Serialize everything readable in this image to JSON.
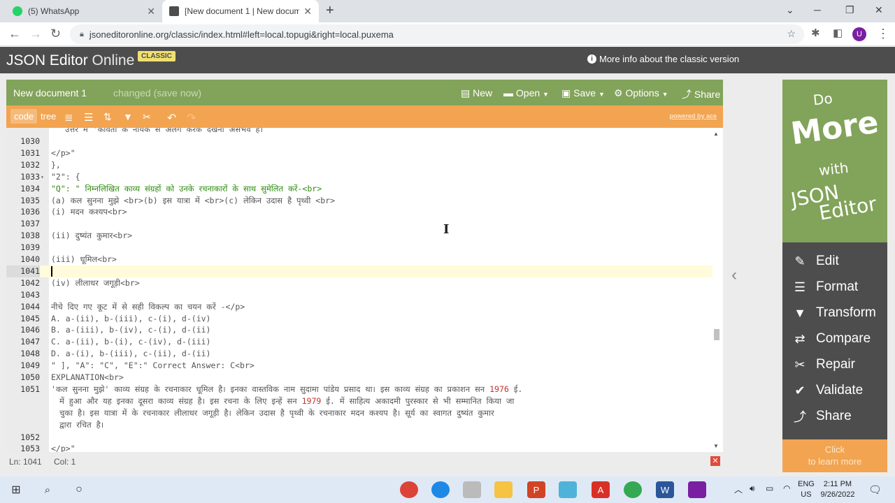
{
  "browser": {
    "tabs": [
      {
        "title": "(5) WhatsApp",
        "active": false
      },
      {
        "title": "[New document 1 | New docume",
        "active": true
      }
    ],
    "url": "jsoneditoronline.org/classic/index.html#left=local.topugi&right=local.puxema",
    "profile_initial": "U"
  },
  "app": {
    "brand_main": "JSON Editor",
    "brand_thin": "Online",
    "badge": "CLASSIC",
    "more_info": "More info about the classic version"
  },
  "menubar": {
    "doc_name": "New document 1",
    "changed": "changed (save now)",
    "items": [
      "New",
      "Open",
      "Save",
      "Options",
      "Share"
    ]
  },
  "toolbar": {
    "code": "code",
    "tree": "tree",
    "powered_by": "powered by ace"
  },
  "editor": {
    "partial_top": "उत्तर में 'कविता के नायक से अलग करके देखना असंभव है।",
    "lines": [
      {
        "n": "1030",
        "text": ""
      },
      {
        "n": "1031",
        "text": "</p>\""
      },
      {
        "n": "1032",
        "text": "},"
      },
      {
        "n": "1033",
        "text": "\"2\": {",
        "fold": true
      },
      {
        "n": "1034",
        "text": "\"Q\": \" निम्नलिखित काव्य संग्रहों को उनके रचनाकारों के साथ सुमेलित करें-<br>"
      },
      {
        "n": "1035",
        "text": "(a) कल सुनना मुझे <br>(b) इस यात्रा में <br>(c) लेकिन उदास है पृथ्वी  <br>"
      },
      {
        "n": "1036",
        "text": "(i) मदन कश्यप<br>"
      },
      {
        "n": "1037",
        "text": ""
      },
      {
        "n": "1038",
        "text": "(ii) दुष्यंत कुमार<br>"
      },
      {
        "n": "1039",
        "text": ""
      },
      {
        "n": "1040",
        "text": "(iii) धूमिल<br>"
      },
      {
        "n": "1041",
        "text": "",
        "active": true
      },
      {
        "n": "1042",
        "text": "(iv) लीलाधर जगूड़ी<br>"
      },
      {
        "n": "1043",
        "text": ""
      },
      {
        "n": "1044",
        "text": "नीचे दिए गए कूट में से सही विकल्प का चयन करें -</p>"
      },
      {
        "n": "1045",
        "text": "A. a-(ii), b-(iii), c-(i), d-(iv)"
      },
      {
        "n": "1046",
        "text": "B. a-(iii), b-(iv), c-(i), d-(ii)"
      },
      {
        "n": "1047",
        "text": "C. a-(ii), b-(i), c-(iv), d-(iii)"
      },
      {
        "n": "1048",
        "text": "D. a-(i), b-(iii), c-(ii), d-(ii)"
      },
      {
        "n": "1049",
        "text": "\" ], \"A\": \"C\", \"E\":\"   Correct Answer: C<br>"
      },
      {
        "n": "1050",
        "text": "EXPLANATION<br>"
      }
    ],
    "para_line_number": "1051",
    "para_lines": [
      [
        "'कल सुनना मुझे' काव्य संग्रह के रचनाकार धूमिल है। इनका वास्तविक नाम सुदामा पांडेय प्रसाद था। इस काव्य संग्रह का प्रकाशन सन ",
        "1976",
        " ई."
      ],
      [
        " में हुआ और यह इनका दूसरा काव्य संग्रह है। इस रचना के लिए इन्हें सन ",
        "1979",
        " ई. में साहित्य अकादमी पुरस्कार से भी सम्मानित किया जा"
      ],
      [
        " चुका है। इस यात्रा में के रचनाकार लीलाधर जगूड़ी है। लेकिन उदास है पृथ्वी के रचनाकार मदन कश्यप है। सूर्य का स्वागत दुष्यंत कुमार",
        "",
        ""
      ],
      [
        " द्वारा रचित है।",
        "",
        ""
      ]
    ],
    "tail_lines": [
      {
        "n": "1052",
        "text": ""
      },
      {
        "n": "1053",
        "text": "</p>\""
      }
    ]
  },
  "status": {
    "ln": "Ln: 1041",
    "col": "Col: 1"
  },
  "ad": {
    "words": [
      "Do",
      "More",
      "with",
      "JSON",
      "Editor"
    ],
    "items": [
      {
        "label": "Edit",
        "icon": "✎"
      },
      {
        "label": "Format",
        "icon": "☰"
      },
      {
        "label": "Transform",
        "icon": "▼"
      },
      {
        "label": "Compare",
        "icon": "⇄"
      },
      {
        "label": "Repair",
        "icon": "✂"
      },
      {
        "label": "Validate",
        "icon": "✔"
      },
      {
        "label": "Share",
        "icon": "⤴"
      }
    ],
    "cta_line1": "Click",
    "cta_line2": "to learn more"
  },
  "taskbar": {
    "lang_line1": "ENG",
    "lang_line2": "US",
    "time": "2:11 PM",
    "date": "9/26/2022"
  },
  "colors": {
    "green": "#82a35a",
    "orange": "#f2a451",
    "dark": "#4d4d4d"
  }
}
